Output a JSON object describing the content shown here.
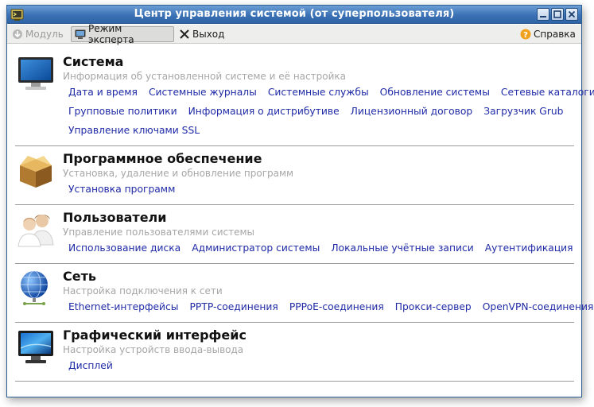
{
  "window": {
    "title": "Центр управления системой (от суперпользователя)"
  },
  "toolbar": {
    "module_label": "Модуль",
    "expert_label": "Режим эксперта",
    "exit_label": "Выход",
    "help_label": "Справка"
  },
  "sections": [
    {
      "title": "Система",
      "description": "Информация об установленной системе и её настройка",
      "icon": "monitor-icon",
      "link_rows": [
        [
          "Дата и время",
          "Системные журналы",
          "Системные службы",
          "Обновление системы",
          "Сетевые каталоги"
        ],
        [
          "Групповые политики",
          "Информация о дистрибутиве",
          "Лицензионный договор",
          "Загрузчик Grub"
        ],
        [
          "Управление ключами SSL"
        ]
      ]
    },
    {
      "title": "Программное обеспечение",
      "description": "Установка, удаление и обновление программ",
      "icon": "package-box-icon",
      "link_rows": [
        [
          "Установка программ"
        ]
      ]
    },
    {
      "title": "Пользователи",
      "description": "Управление пользователями системы",
      "icon": "users-icon",
      "link_rows": [
        [
          "Использование диска",
          "Администратор системы",
          "Локальные учётные записи",
          "Аутентификация"
        ]
      ]
    },
    {
      "title": "Сеть",
      "description": "Настройка подключения к сети",
      "icon": "network-globe-icon",
      "link_rows": [
        [
          "Ethernet-интерфейсы",
          "PPTP-соединения",
          "PPPoE-соединения",
          "Прокси-сервер",
          "OpenVPN-соединения"
        ]
      ]
    },
    {
      "title": "Графический интерфейс",
      "description": "Настройка устройств ввода-вывода",
      "icon": "display-icon",
      "link_rows": [
        [
          "Дисплей"
        ]
      ]
    }
  ]
}
